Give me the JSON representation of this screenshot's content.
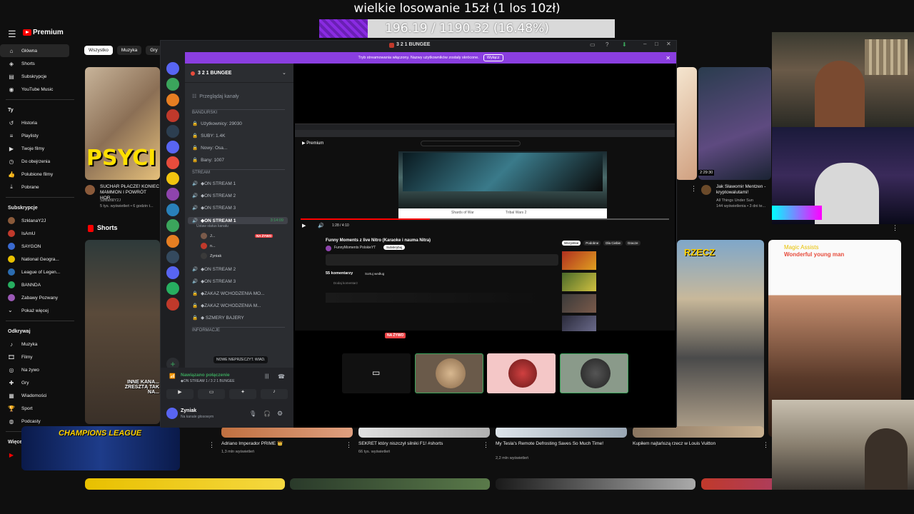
{
  "overlay": {
    "title": "wielkie losowanie 15zł (1 los 10zł)",
    "progress_text": "196.19 / 1190.32 (16.48%)",
    "progress_fraction": 0.1648
  },
  "youtube": {
    "logo": "Premium",
    "chips": [
      "Wszystko",
      "Muzyka",
      "Gry"
    ],
    "sidebar": {
      "main": [
        {
          "label": "Główna",
          "icon": "home-icon"
        },
        {
          "label": "Shorts",
          "icon": "shorts-icon"
        },
        {
          "label": "Subskrypcje",
          "icon": "subscriptions-icon"
        },
        {
          "label": "YouTube Music",
          "icon": "music-icon"
        }
      ],
      "you_heading": "Ty",
      "you": [
        {
          "label": "Historia",
          "icon": "history-icon"
        },
        {
          "label": "Playlisty",
          "icon": "playlist-icon"
        },
        {
          "label": "Twoje filmy",
          "icon": "video-icon"
        },
        {
          "label": "Do obejrzenia",
          "icon": "clock-icon"
        },
        {
          "label": "Polubione filmy",
          "icon": "like-icon"
        },
        {
          "label": "Pobrane",
          "icon": "download-icon"
        }
      ],
      "subs_heading": "Subskrypcje",
      "subs": [
        {
          "label": "SzklanaY2J",
          "color": "#8a5a3a"
        },
        {
          "label": "IsAmU",
          "color": "#c0392b"
        },
        {
          "label": "SAYGON",
          "color": "#3a6ad0"
        },
        {
          "label": "National Geogra...",
          "color": "#e8c000"
        },
        {
          "label": "League of Legen...",
          "color": "#2b6cb0"
        },
        {
          "label": "BANNDA",
          "color": "#27ae60"
        },
        {
          "label": "Zabawy Pozwany",
          "color": "#9b59b6"
        },
        {
          "label": "Pokaż więcej",
          "color": ""
        }
      ],
      "explore_heading": "Odkrywaj",
      "explore": [
        {
          "label": "Muzyka",
          "icon": "music-note-icon"
        },
        {
          "label": "Filmy",
          "icon": "film-icon"
        },
        {
          "label": "Na żywo",
          "icon": "live-icon"
        },
        {
          "label": "Gry",
          "icon": "gamepad-icon"
        },
        {
          "label": "Wiadomości",
          "icon": "news-icon"
        },
        {
          "label": "Sport",
          "icon": "trophy-icon"
        },
        {
          "label": "Podcasty",
          "icon": "podcast-icon"
        }
      ],
      "more_heading": "Więcej",
      "more": [
        {
          "label": "YouTube Kids"
        }
      ]
    },
    "shorts_label": "Shorts",
    "videos": [
      {
        "title": "SUCHAR PŁACZE! KONIEC MAMMON I POWRÓT HOR...",
        "meta1": "SzklanaY2J",
        "meta2": "5 tys. wyświetleń • 6 godzin t..."
      },
      {
        "title": "Jak Sławomir Mentzen - kryptowalutami!",
        "meta1": "All Things Under Sun",
        "meta2": "144 wyświetlenia • 3 dni te..."
      },
      {
        "title": "Adriano Imperador PRIME 👑",
        "meta1": "1,3 mln wyświetleń",
        "meta2": ""
      },
      {
        "title": "SEKRET który niszczył silniki F1! #shorts",
        "meta1": "66 tys. wyświetleń",
        "meta2": ""
      },
      {
        "title": "My Tesla's Remote Defrosting Saves So Much Time!",
        "meta1": "2,2 mln wyświetleń",
        "meta2": ""
      },
      {
        "title": "Kupiłem najtańszą rzecz w Louis Vuitton",
        "meta1": "",
        "meta2": ""
      }
    ],
    "short_captions": [
      "PSYCI",
      "INNE KANA... ZRESZTĄ TAK NA...",
      "RZECZ",
      "Magic Assists",
      "Wonderful young man",
      "CHAMPIONS LEAGUE"
    ],
    "duration": "2:29:30"
  },
  "discord": {
    "window_title": "3 2 1 BUNGEE",
    "banner_text": "Tryb streamowania włączony. Nazwy użytkowników zostały skrócone.",
    "banner_button": "Wyłącz",
    "server_name": "3 2 1 BUNGEE",
    "browse_channels": "Przeglądaj kanały",
    "categories": [
      "BANDURSKI",
      "STREAM",
      "INFORMACJE"
    ],
    "stats": [
      "Użytkownicy: 29030",
      "SUBY: 1.4K",
      "Nowy: Osa...",
      "Bany: 1007"
    ],
    "stream_channels": [
      "◆ON STREAM 1",
      "◆ON STREAM 2",
      "◆ON STREAM 3"
    ],
    "active_channel": "◆ON STREAM 1",
    "active_timer": "3:14:09",
    "status_hint": "Ustaw status kanału",
    "members": [
      "J...",
      "n...",
      "Zyniak"
    ],
    "live_badge": "NA ŻYWO",
    "more_channels": [
      "◆ON STREAM 2",
      "◆ON STREAM 3",
      "◆ZAKAZ WCHODZENIA MO...",
      "◆ZAKAZ WCHODZENIA M...",
      "◆ SZMERY BAJERY"
    ],
    "tooltip": "NOWE NIEPRZECZYT. WIAD.",
    "voice_connected": "Nawiązano połączenie",
    "voice_channel": "◆ON STREAM 1 / 3 2 1 BUNGEE",
    "user_name": "Zyniak",
    "user_status": "Na kanale głosowym"
  },
  "stream": {
    "inner_title": "Funny Moments z live Nitro (Karaoke i nauma Nitra)",
    "inner_channel": "FunnyMoments PolskieYT",
    "subscribe": "Subskrybuj",
    "comments": "55 komentarzy",
    "sort": "Sortuj według",
    "add_comment": "Dodaj komentarz",
    "time": "1:28 / 4:10",
    "tabs_right": [
      "Wszystkie",
      "Podobne",
      "Dla Ciebie",
      "Gracze"
    ],
    "live_badge": "NA ŻYWO",
    "inner_video_caption_left": "Shards of War",
    "inner_video_caption_right": "Tribal Wars 2"
  }
}
